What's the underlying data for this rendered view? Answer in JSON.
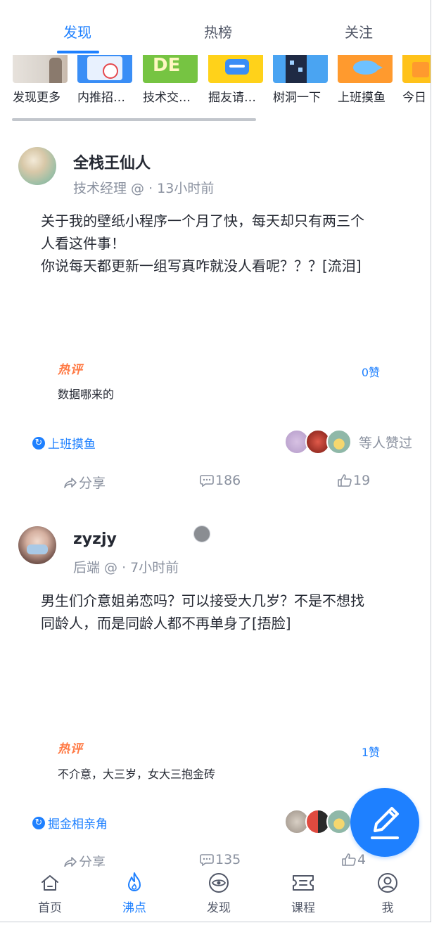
{
  "tabs": [
    {
      "label": "发现",
      "active": true
    },
    {
      "label": "热榜",
      "active": false
    },
    {
      "label": "关注",
      "active": false
    }
  ],
  "topics": [
    {
      "label": "发现更多",
      "icon": "photo-thumbnail"
    },
    {
      "label": "内推招…",
      "icon": "clipboard-check-icon"
    },
    {
      "label": "技术交…",
      "icon": "de-badge-icon"
    },
    {
      "label": "掘友请…",
      "icon": "chat-bubble-icon"
    },
    {
      "label": "树洞一下",
      "icon": "building-icon"
    },
    {
      "label": "上班摸鱼",
      "icon": "fish-icon"
    },
    {
      "label": "今日",
      "icon": "note-icon"
    }
  ],
  "posts": [
    {
      "author": "全栈王仙人",
      "meta": "技术经理 @ · 13小时前",
      "content": [
        "关于我的壁纸小程序一个月了快，每天却只有两三个",
        "人看这件事！",
        "你说每天都更新一组写真咋就没人看呢？？？[流泪]"
      ],
      "hot_label": "热评",
      "hot_comment": "数据哪来的",
      "hot_likes": "0赞",
      "circle": "上班摸鱼",
      "liked_text": "等人赞过",
      "share": "分享",
      "comments": "186",
      "likes": "19"
    },
    {
      "author": "zyzjy",
      "meta": "后端 @ · 7小时前",
      "content": [
        "男生们介意姐弟恋吗？可以接受大几岁？不是不想找",
        "同龄人，而是同龄人都不再单身了[捂脸]"
      ],
      "hot_label": "热评",
      "hot_comment": "不介意，大三岁，女大三抱金砖",
      "hot_likes": "1赞",
      "circle": "掘金相亲角",
      "liked_text": "",
      "share": "分享",
      "comments": "135",
      "likes": "4"
    }
  ],
  "nav": [
    {
      "label": "首页",
      "icon": "home-icon",
      "active": false
    },
    {
      "label": "沸点",
      "icon": "flame-icon",
      "active": true
    },
    {
      "label": "发现",
      "icon": "eye-icon",
      "active": false
    },
    {
      "label": "课程",
      "icon": "ticket-icon",
      "active": false
    },
    {
      "label": "我",
      "icon": "user-icon",
      "active": false
    }
  ],
  "colors": {
    "accent": "#1e80ff",
    "hot": "#ff7a45",
    "muted": "#8a919f"
  }
}
